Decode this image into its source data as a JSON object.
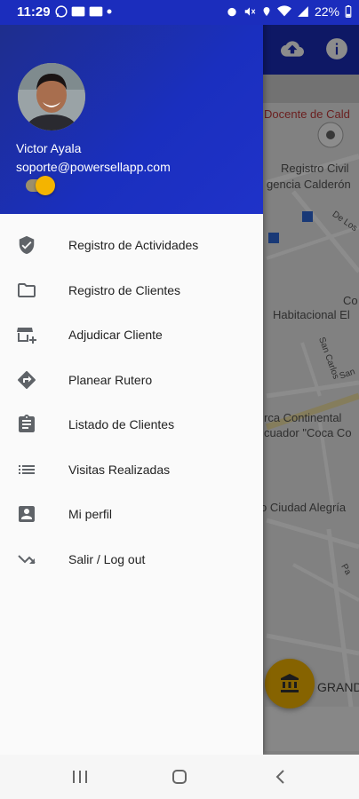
{
  "status_bar": {
    "time": "11:29",
    "battery": "22%",
    "background": "#1b2dbd"
  },
  "user": {
    "name": "Victor Ayala",
    "email": "soporte@powersellapp.com"
  },
  "menu": [
    {
      "label": "Registro de Actividades",
      "icon": "verified-shield-icon"
    },
    {
      "label": "Registro de Clientes",
      "icon": "folder-icon"
    },
    {
      "label": "Adjudicar Cliente",
      "icon": "store-add-icon"
    },
    {
      "label": "Planear Rutero",
      "icon": "directions-icon"
    },
    {
      "label": "Listado de Clientes",
      "icon": "clipboard-icon"
    },
    {
      "label": "Visitas Realizadas",
      "icon": "list-icon"
    },
    {
      "label": "Mi perfil",
      "icon": "account-box-icon"
    },
    {
      "label": "Salir / Log out",
      "icon": "logout-arrow-icon"
    }
  ],
  "map": {
    "labels": [
      "Docente de Cald",
      "Registro Civil",
      "gencia Calderón",
      "De Los",
      "Co",
      "Habitacional El",
      "San Carlos",
      "San",
      "rca Continental",
      "cuador \"Coca Co",
      "o Ciudad Alegría",
      "GRAND",
      "Pa"
    ]
  },
  "colors": {
    "header": "#1b2db8",
    "accent": "#f4b400"
  }
}
